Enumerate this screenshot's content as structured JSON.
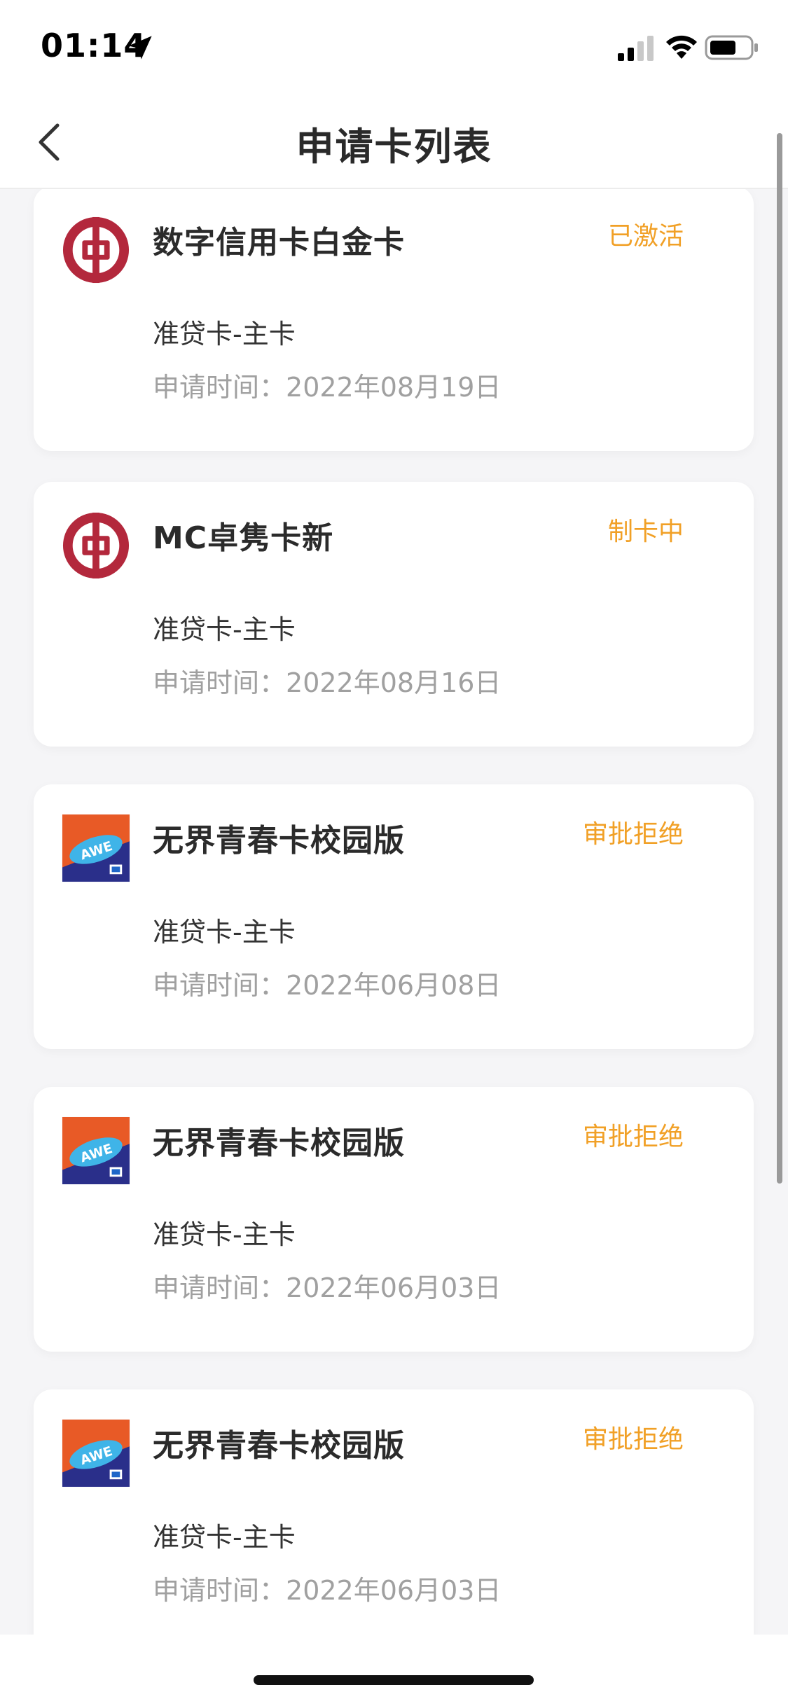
{
  "status_bar": {
    "time": "01:14"
  },
  "nav": {
    "title": "申请卡列表"
  },
  "cards": [
    {
      "logo": "boc-logo-icon",
      "name": "数字信用卡白金卡",
      "status": "已激活",
      "type": "准贷卡-主卡",
      "date_label": "申请时间：",
      "date": "2022年08月19日"
    },
    {
      "logo": "boc-logo-icon",
      "name": "MC卓隽卡新",
      "status": "制卡中",
      "type": "准贷卡-主卡",
      "date_label": "申请时间：",
      "date": "2022年08月16日"
    },
    {
      "logo": "awesome-card-icon",
      "name": "无界青春卡校园版",
      "status": "审批拒绝",
      "type": "准贷卡-主卡",
      "date_label": "申请时间：",
      "date": "2022年06月08日"
    },
    {
      "logo": "awesome-card-icon",
      "name": "无界青春卡校园版",
      "status": "审批拒绝",
      "type": "准贷卡-主卡",
      "date_label": "申请时间：",
      "date": "2022年06月03日"
    },
    {
      "logo": "awesome-card-icon",
      "name": "无界青春卡校园版",
      "status": "审批拒绝",
      "type": "准贷卡-主卡",
      "date_label": "申请时间：",
      "date": "2022年06月03日"
    }
  ],
  "colors": {
    "status_accent": "#f1a026",
    "boc_red": "#b3283c",
    "background": "#f5f5f7"
  }
}
